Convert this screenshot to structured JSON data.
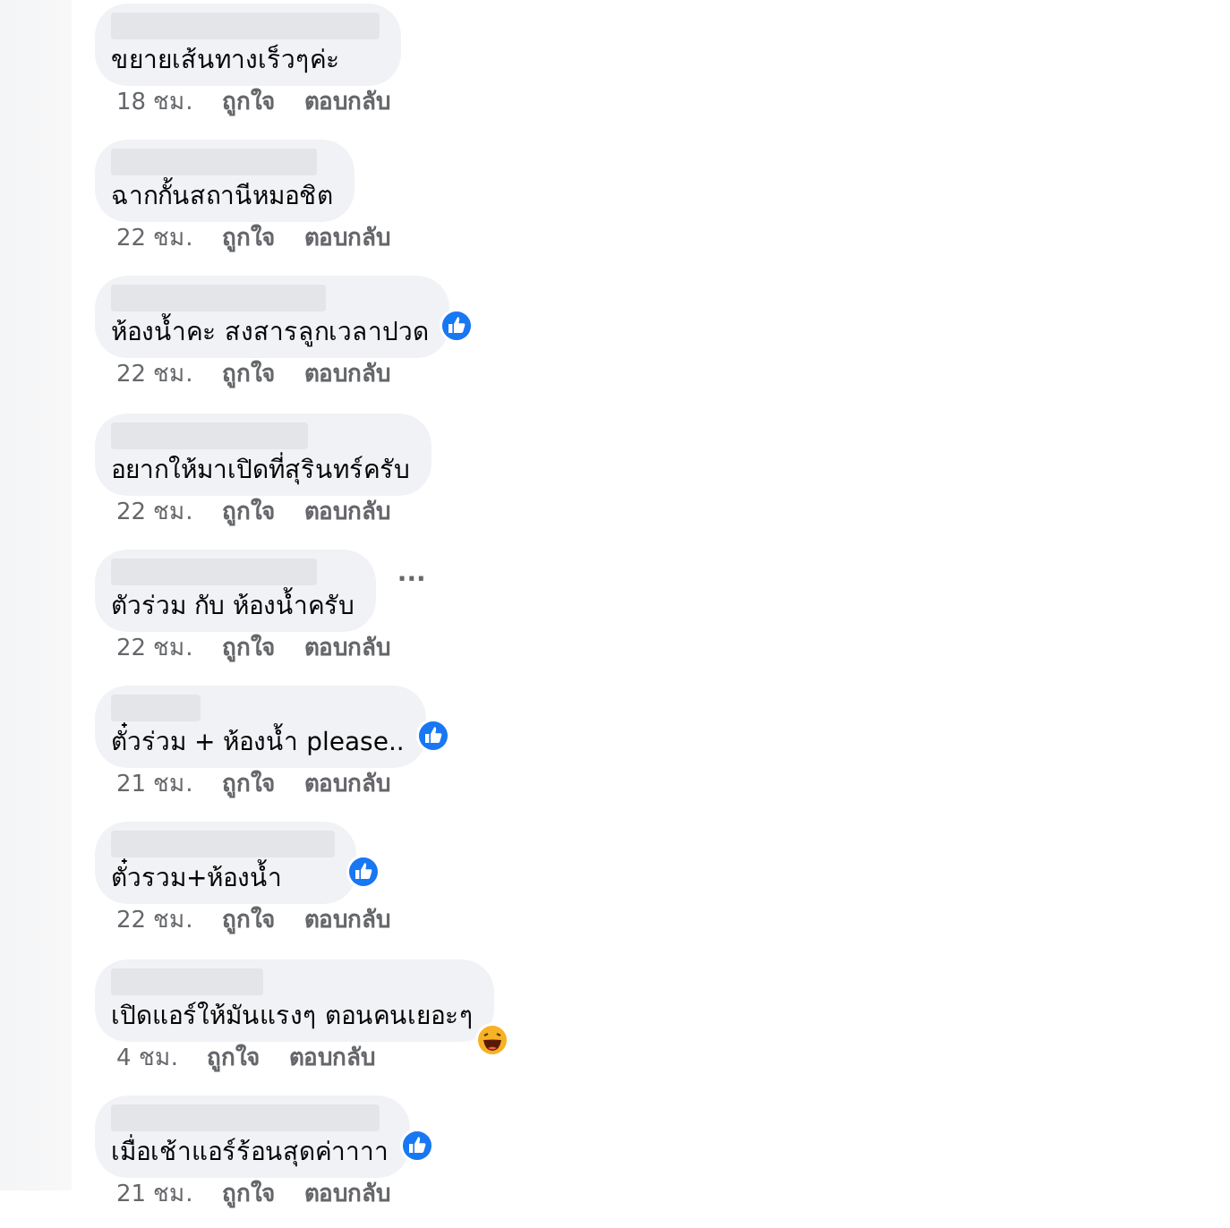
{
  "comments": [
    {
      "text": "ขยายเส้นทางเร็วๆค่ะ",
      "time": "18 ชม.",
      "like": "ถูกใจ",
      "reply": "ตอบกลับ"
    },
    {
      "text": "ฉากกั้นสถานีหมอชิต",
      "time": "22 ชม.",
      "like": "ถูกใจ",
      "reply": "ตอบกลับ"
    },
    {
      "text": "ห้องน้ำคะ สงสารลูกเวลาปวด",
      "time": "22 ชม.",
      "like": "ถูกใจ",
      "reply": "ตอบกลับ",
      "kind": "liked"
    },
    {
      "text": "อยากให้มาเปิดที่สุรินทร์ครับ",
      "time": "22 ชม.",
      "like": "ถูกใจ",
      "reply": "ตอบกลับ"
    },
    {
      "text": "ตัวร่วม กับ ห้องน้ำครับ",
      "time": "22 ชม.",
      "like": "ถูกใจ",
      "reply": "ตอบกลับ",
      "more": "···"
    },
    {
      "text": "ตั๋วร่วม + ห้องน้ำ please..",
      "time": "21 ชม.",
      "like": "ถูกใจ",
      "reply": "ตอบกลับ",
      "kind": "liked"
    },
    {
      "text": "ตั๋วรวม+ห้องน้ำ",
      "time": "22 ชม.",
      "like": "ถูกใจ",
      "reply": "ตอบกลับ",
      "kind": "liked"
    },
    {
      "text": "เปิดแอร์ให้มันแรงๆ ตอนคนเยอะๆ",
      "time": "4 ชม.",
      "like": "ถูกใจ",
      "reply": "ตอบกลับ",
      "kind": "laughed"
    },
    {
      "text": "เมื่อเช้าแอร์ร้อนสุดค่าาาา",
      "time": "21 ชม.",
      "like": "ถูกใจ",
      "reply": "ตอบกลับ",
      "kind": "liked"
    }
  ]
}
